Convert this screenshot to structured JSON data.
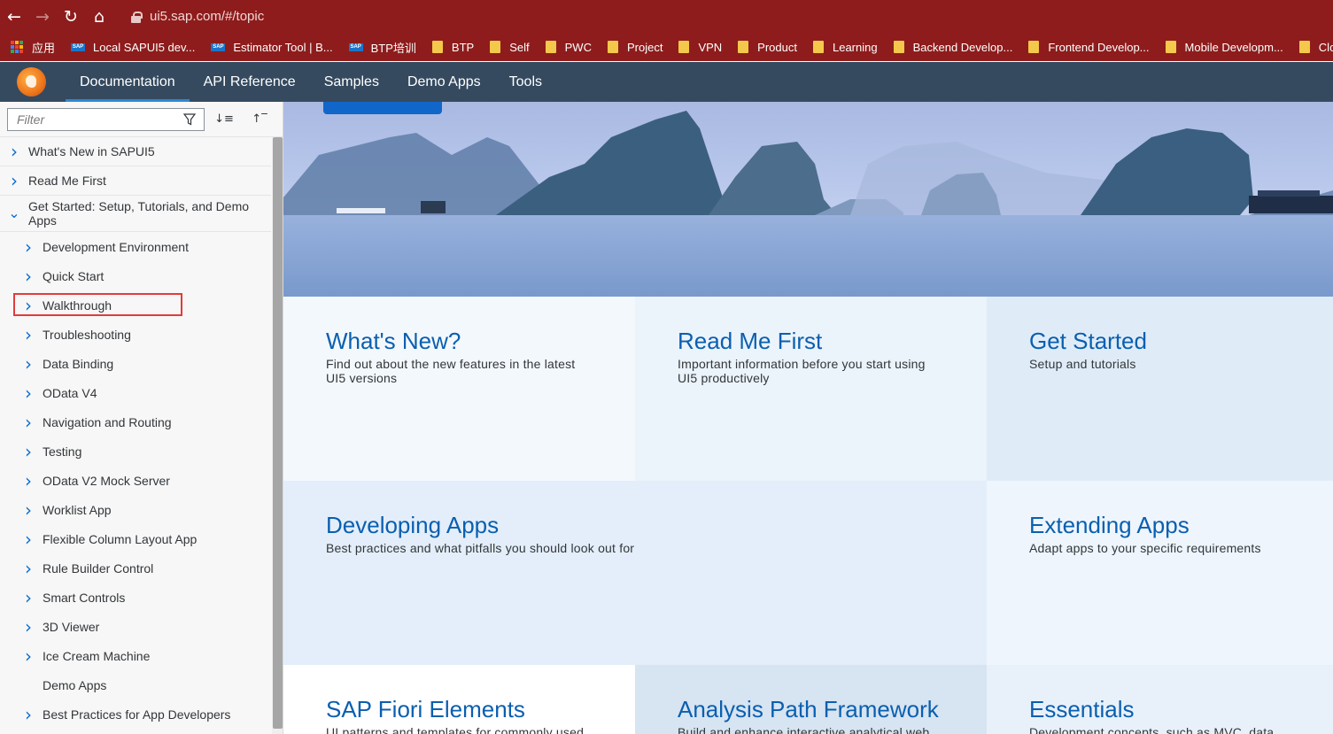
{
  "browser": {
    "url": "ui5.sap.com/#/topic",
    "bookmarks": [
      {
        "label": "应用",
        "icon": "apps-grid-icon"
      },
      {
        "label": "Local SAPUI5 dev...",
        "icon": "sap-logo-icon"
      },
      {
        "label": "Estimator Tool | B...",
        "icon": "sap-logo-icon"
      },
      {
        "label": "BTP培训",
        "icon": "sap-logo-icon"
      },
      {
        "label": "BTP",
        "icon": "folder-icon"
      },
      {
        "label": "Self",
        "icon": "folder-icon"
      },
      {
        "label": "PWC",
        "icon": "folder-icon"
      },
      {
        "label": "Project",
        "icon": "folder-icon"
      },
      {
        "label": "VPN",
        "icon": "folder-icon"
      },
      {
        "label": "Product",
        "icon": "folder-icon"
      },
      {
        "label": "Learning",
        "icon": "folder-icon"
      },
      {
        "label": "Backend Develop...",
        "icon": "folder-icon"
      },
      {
        "label": "Frontend Develop...",
        "icon": "folder-icon"
      },
      {
        "label": "Mobile Developm...",
        "icon": "folder-icon"
      },
      {
        "label": "Cloud",
        "icon": "folder-icon"
      }
    ]
  },
  "shell": {
    "tabs": [
      {
        "label": "Documentation",
        "active": true
      },
      {
        "label": "API Reference"
      },
      {
        "label": "Samples"
      },
      {
        "label": "Demo Apps"
      },
      {
        "label": "Tools"
      }
    ]
  },
  "sidebar": {
    "filter_placeholder": "Filter",
    "tree": [
      {
        "label": "What's New in SAPUI5",
        "level": 0,
        "expanded": false
      },
      {
        "label": "Read Me First",
        "level": 0,
        "expanded": false
      },
      {
        "label": "Get Started: Setup, Tutorials, and Demo Apps",
        "level": 0,
        "expanded": true
      },
      {
        "label": "Development Environment",
        "level": 1
      },
      {
        "label": "Quick Start",
        "level": 1
      },
      {
        "label": "Walkthrough",
        "level": 1,
        "highlighted": true
      },
      {
        "label": "Troubleshooting",
        "level": 1
      },
      {
        "label": "Data Binding",
        "level": 1
      },
      {
        "label": "OData V4",
        "level": 1
      },
      {
        "label": "Navigation and Routing",
        "level": 1
      },
      {
        "label": "Testing",
        "level": 1
      },
      {
        "label": "OData V2 Mock Server",
        "level": 1
      },
      {
        "label": "Worklist App",
        "level": 1
      },
      {
        "label": "Flexible Column Layout App",
        "level": 1
      },
      {
        "label": "Rule Builder Control",
        "level": 1
      },
      {
        "label": "Smart Controls",
        "level": 1
      },
      {
        "label": "3D Viewer",
        "level": 1
      },
      {
        "label": "Ice Cream Machine",
        "level": 1
      },
      {
        "label": "Demo Apps",
        "level": 1,
        "leaf": true
      },
      {
        "label": "Best Practices for App Developers",
        "level": 1
      }
    ]
  },
  "tiles": [
    {
      "title": "What's New?",
      "desc": "Find out about the new features in the latest UI5 versions",
      "bg": "#f3f8fd"
    },
    {
      "title": "Read Me First",
      "desc": "Important information before you start using UI5 productively",
      "bg": "#ebf3fb"
    },
    {
      "title": "Get Started",
      "desc": "Setup and tutorials",
      "bg": "#dfecf8"
    },
    {
      "title": "Developing Apps",
      "desc": "Best practices and what pitfalls you should look out for",
      "bg": "#e3eefa"
    },
    {
      "title": "Extending Apps",
      "desc": "Adapt apps to your specific requirements",
      "bg": "#eef5fc"
    },
    {
      "title": "SAP Fiori Elements",
      "desc": "UI patterns and templates for commonly used",
      "bg": "#ffffff"
    },
    {
      "title": "Analysis Path Framework",
      "desc": "Build and enhance interactive analytical web",
      "bg": "#d7e4f1"
    },
    {
      "title": "Essentials",
      "desc": "Development concepts, such as MVC, data",
      "bg": "#e8f1fa"
    }
  ]
}
